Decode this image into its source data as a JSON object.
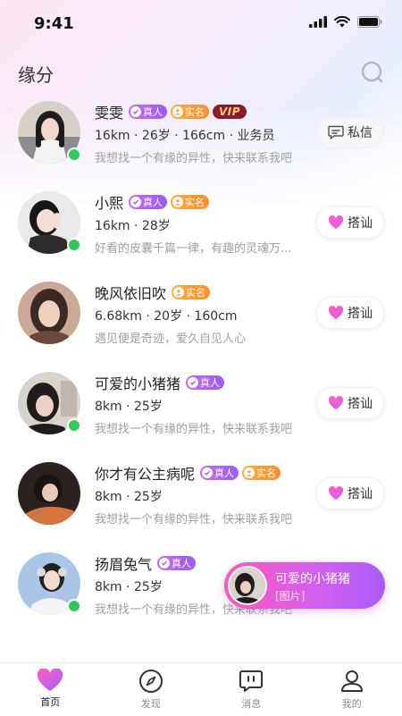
{
  "status_bar": {
    "time": "9:41"
  },
  "header": {
    "title": "缘分"
  },
  "badges": {
    "real": "真人",
    "realname": "实名",
    "vip": "VIP"
  },
  "users": [
    {
      "name": "雯雯",
      "info": "16km · 26岁 · 166cm · 业务员",
      "motto": "我想找一个有缘的异性，快来联系我吧",
      "action": "私信"
    },
    {
      "name": "小熙",
      "info": "16km · 28岁",
      "motto": "好看的皮囊千篇一律，有趣的灵魂万...",
      "action": "搭讪"
    },
    {
      "name": "晚风依旧吹",
      "info": "6.68km · 20岁 · 160cm",
      "motto": "遇见便是奇迹，爱久自见人心",
      "action": "搭讪"
    },
    {
      "name": "可爱的小猪猪",
      "info": "8km · 25岁",
      "motto": "我想找一个有缘的异性，快来联系我吧",
      "action": "搭讪"
    },
    {
      "name": "你才有公主病呢",
      "info": "8km · 25岁",
      "motto": "我想找一个有缘的异性，快来联系我吧",
      "action": "搭讪"
    },
    {
      "name": "扬眉兔气",
      "info": "8km · 25岁",
      "motto": "我想找一个有缘的异性，快来联系我吧"
    }
  ],
  "toast": {
    "name": "可爱的小猪猪",
    "message": "[图片]"
  },
  "tabs": [
    {
      "label": "首页",
      "icon": "heart-icon"
    },
    {
      "label": "发现",
      "icon": "compass-icon"
    },
    {
      "label": "消息",
      "icon": "message-icon"
    },
    {
      "label": "我的",
      "icon": "profile-icon"
    }
  ],
  "colors": {
    "accent_pink": "#ff58b6",
    "accent_purple": "#a85cf8",
    "online": "#31c95a",
    "vip_bg": "#8b1a2e"
  }
}
